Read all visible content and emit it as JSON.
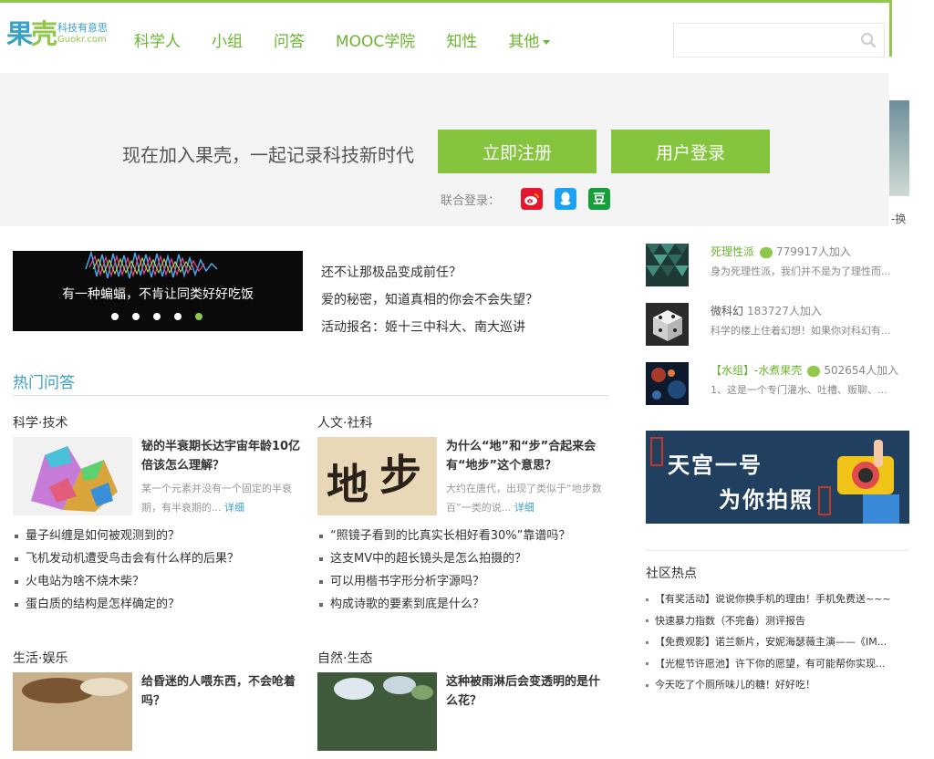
{
  "brand": {
    "mark_a": "果",
    "mark_b": "壳",
    "tagline": "科技有意思",
    "domain": "Guokr.com"
  },
  "nav": {
    "items": [
      "科学人",
      "小组",
      "问答",
      "MOOC学院",
      "知性"
    ],
    "more": "其他"
  },
  "search": {
    "placeholder": ""
  },
  "join": {
    "text": "现在加入果壳，一起记录科技新时代",
    "register": "立即注册",
    "login": "用户登录",
    "social_label": "联合登录：",
    "douban": "豆"
  },
  "peek_text": "-换",
  "slider": {
    "caption": "有一种蝙蝠，不肯让同类好好吃饭",
    "active_dot": 5,
    "dot_count": 5
  },
  "headlines": [
    "还不让那极品变成前任？",
    "爱的秘密，知道真相的你会不会失望？",
    "活动报名：姬十三中科大、南大巡讲"
  ],
  "hot_qa": {
    "title": "热门问答",
    "categories": [
      {
        "name": "科学·技术",
        "feature_title": "铋的半衰期长达宇宙年龄10亿倍该怎么理解？",
        "feature_desc": "某一个元素并没有一个固定的半衰期，有半衰期的...",
        "more": "详细",
        "questions": [
          "量子纠缠是如何被观测到的？",
          "飞机发动机遭受鸟击会有什么样的后果？",
          "火电站为啥不烧木柴？",
          "蛋白质的结构是怎样确定的？"
        ]
      },
      {
        "name": "人文·社科",
        "feature_title": "为什么“地”和“步”合起来会有“地步”这个意思？",
        "feature_desc": "大约在唐代，出现了类似于“地步数百”一类的说...",
        "more": "详细",
        "questions": [
          "“照镜子看到的比真实长相好看30%”靠谱吗？",
          "这支MV中的超长镜头是怎么拍摄的？",
          "可以用楷书字形分析字源吗？",
          "构成诗歌的要素到底是什么？"
        ]
      },
      {
        "name": "生活·娱乐",
        "feature_title": "给昏迷的人喂东西，不会呛着吗？"
      },
      {
        "name": "自然·生态",
        "feature_title": "这种被雨淋后会变透明的是什么花？"
      }
    ]
  },
  "groups": [
    {
      "name": "死理性派",
      "count": "779917人加入",
      "desc": "身为死理性派，我们并不是为了理性而..."
    },
    {
      "name": "微科幻",
      "count": "183727人加入",
      "desc": "科学的楼上住着幻想！如果你对科幻有..."
    },
    {
      "name": "【水组】-水煮果壳",
      "count": "502654人加入",
      "desc": "1、这是一个专门灌水、吐槽、贩聊、..."
    }
  ],
  "ad": {
    "line1": "天宫一号",
    "line2": "为你拍照"
  },
  "community": {
    "title": "社区热点",
    "items": [
      "【有奖活动】说说你换手机的理由！手机免费送~~~",
      "快速暴力指数（不完备）测评报告",
      "【免费观影】诺兰新片，安妮海瑟薇主演——《IM...",
      "【光棍节许愿池】许下你的愿望，有可能帮你实现...",
      "今天吃了个厕所味儿的糖！好好吃！"
    ]
  },
  "colors": {
    "brand_green": "#84c53d",
    "brand_blue": "#3aa1c6",
    "nav_green": "#6bb431"
  }
}
